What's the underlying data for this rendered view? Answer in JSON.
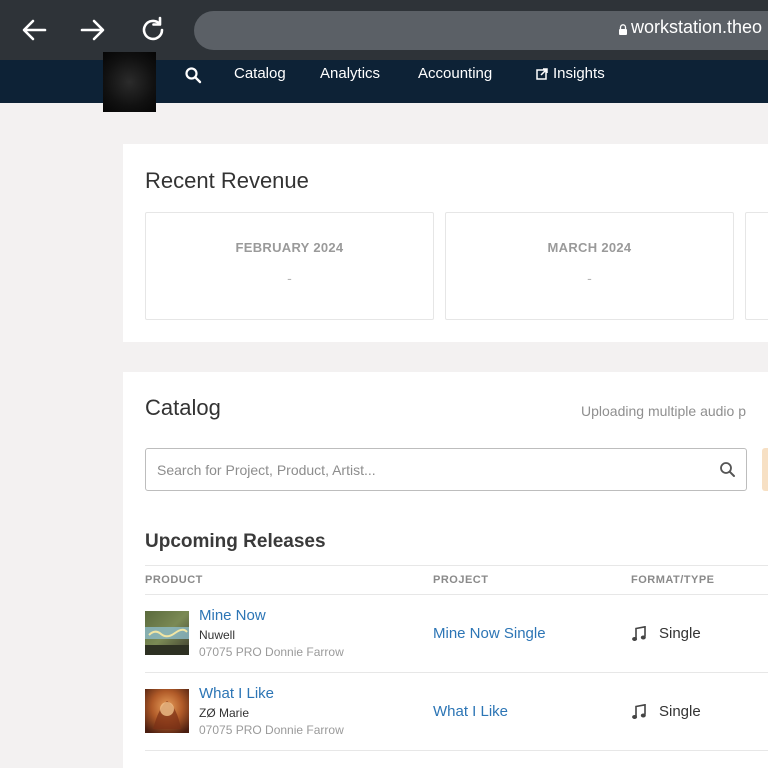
{
  "browser": {
    "url": "workstation.theo",
    "icons": [
      "back-arrow-icon",
      "forward-arrow-icon",
      "reload-icon",
      "lock-icon"
    ]
  },
  "nav": {
    "items": [
      "Catalog",
      "Analytics",
      "Accounting",
      "Insights"
    ],
    "icons": [
      "search-icon",
      "external-link-icon"
    ]
  },
  "revenue": {
    "title": "Recent Revenue",
    "months": [
      {
        "label": "FEBRUARY 2024",
        "value": "-"
      },
      {
        "label": "MARCH 2024",
        "value": "-"
      }
    ]
  },
  "catalog": {
    "title": "Catalog",
    "note": "Uploading multiple audio p",
    "search_placeholder": "Search for Project, Product, Artist...",
    "upcoming_title": "Upcoming Releases",
    "columns": [
      "PRODUCT",
      "PROJECT",
      "FORMAT/TYPE"
    ],
    "rows": [
      {
        "title": "Mine Now",
        "artist": "Nuwell",
        "code": "07075 PRO Donnie Farrow",
        "project": "Mine Now Single",
        "format": "Single"
      },
      {
        "title": "What I Like",
        "artist": "ZØ Marie",
        "code": "07075 PRO Donnie Farrow",
        "project": "What I Like",
        "format": "Single"
      }
    ]
  },
  "colors": {
    "nav_bg": "#0d2236",
    "browser_bg": "#2e3338",
    "link": "#2c75b5",
    "page_bg": "#f3f1f1"
  }
}
